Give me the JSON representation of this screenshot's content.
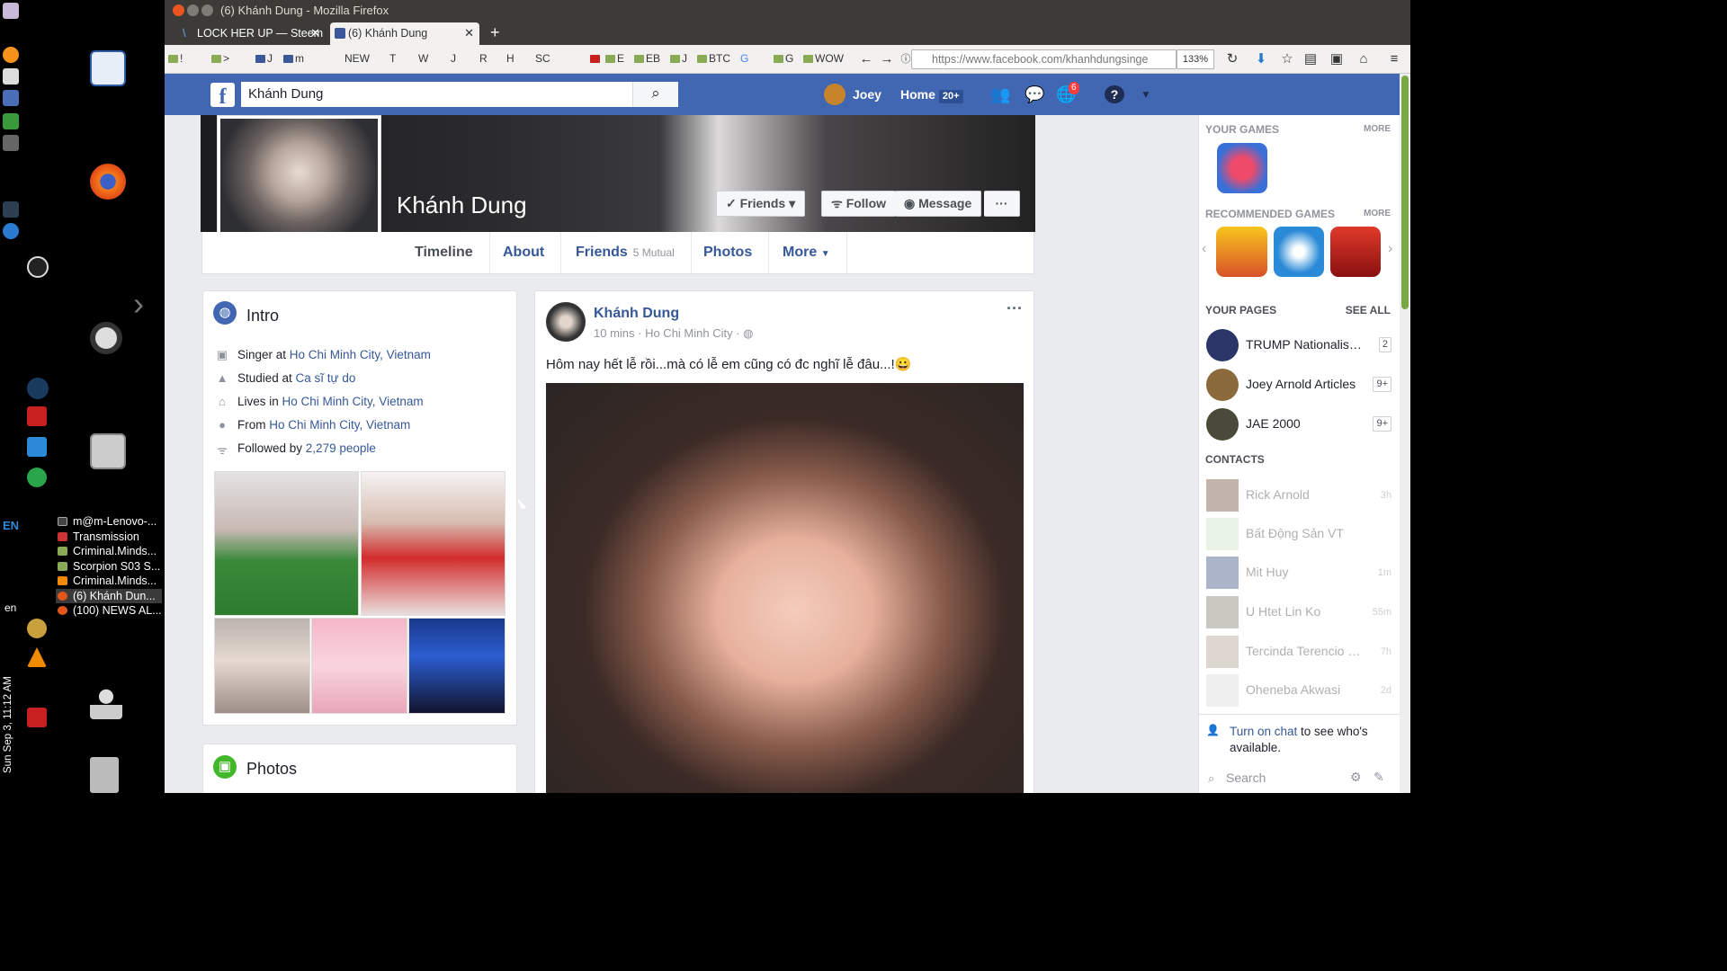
{
  "desktop": {
    "lang": "EN",
    "lang_small": "en",
    "clock": "Sun Sep 3, 11:12 AM",
    "windows": [
      "m@m-Lenovo-...",
      "Transmission",
      "Criminal.Minds...",
      "Scorpion S03 S...",
      "Criminal.Minds...",
      "(6) Khánh Dun...",
      "(100) NEWS AL..."
    ]
  },
  "browser": {
    "title": "(6) Khánh Dung - Mozilla Firefox",
    "tabs": [
      {
        "label": "LOCK HER UP — Steem"
      },
      {
        "label": "(6) Khánh Dung"
      }
    ],
    "new_tab": "+",
    "bookmarks": [
      "!",
      ">",
      "J",
      "m",
      "NEW",
      "T",
      "W",
      "J",
      "R",
      "H",
      "SC",
      "E",
      "EB",
      "J",
      "BTC",
      "G",
      "G",
      "WOW"
    ],
    "url": "https://www.facebook.com/khanhdungsinge",
    "zoom": "133%"
  },
  "fb": {
    "search_value": "Khánh Dung",
    "user": "Joey",
    "home": "Home",
    "home_badge": "20+",
    "notif_badge": "6",
    "profile": {
      "name": "Khánh Dung",
      "buttons": {
        "friends": "Friends",
        "follow": "Follow",
        "message": "Message",
        "more": "···"
      },
      "tabs": [
        {
          "label": "Timeline"
        },
        {
          "label": "About"
        },
        {
          "label": "Friends",
          "sub": "5 Mutual"
        },
        {
          "label": "Photos"
        },
        {
          "label": "More"
        }
      ]
    },
    "intro": {
      "title": "Intro",
      "rows": [
        {
          "pre": "Singer at ",
          "link": "Ho Chi Minh City, Vietnam"
        },
        {
          "pre": "Studied at ",
          "link": "Ca sĩ tự do"
        },
        {
          "pre": "Lives in ",
          "link": "Ho Chi Minh City, Vietnam"
        },
        {
          "pre": "From ",
          "link": "Ho Chi Minh City, Vietnam"
        },
        {
          "pre": "Followed by ",
          "link": "2,279 people"
        }
      ]
    },
    "photos_title": "Photos",
    "post": {
      "author": "Khánh Dung",
      "meta": "10 mins · Ho Chi Minh City ·",
      "text": "Hôm nay hết lễ rồi...mà có lễ em cũng có đc nghĩ lễ đâu...!😀",
      "menu": "···"
    },
    "rail": {
      "games_title": "YOUR GAMES",
      "games_more": "MORE",
      "rec_title": "RECOMMENDED GAMES",
      "rec_more": "MORE",
      "pages_title": "YOUR PAGES",
      "pages_see_all": "SEE ALL",
      "pages": [
        {
          "name": "TRUMP Nationalism ...",
          "count": "2"
        },
        {
          "name": "Joey Arnold Articles",
          "count": "9+"
        },
        {
          "name": "JAE 2000",
          "count": "9+"
        }
      ],
      "contacts_title": "CONTACTS",
      "contacts": [
        {
          "name": "Rick Arnold",
          "time": "3h"
        },
        {
          "name": "Bất Động Sản VT",
          "time": ""
        },
        {
          "name": "Mit Huy",
          "time": "1m"
        },
        {
          "name": "U Htet Lin Ko",
          "time": "55m"
        },
        {
          "name": "Tercinda Terencio Ma...",
          "time": "7h"
        },
        {
          "name": "Oheneba Akwasi",
          "time": "2d"
        }
      ],
      "chat_link": "Turn on chat",
      "chat_rest": " to see who's available.",
      "chat_search": "Search"
    }
  }
}
